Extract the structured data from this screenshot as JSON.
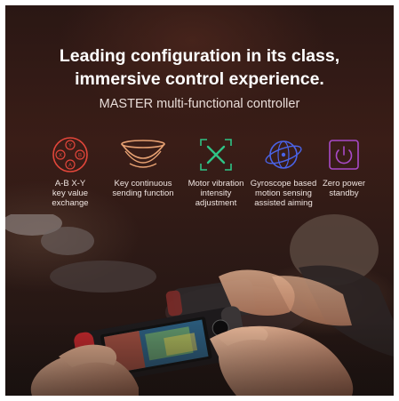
{
  "headline": {
    "line1": "Leading configuration in its class,",
    "line2": "immersive control experience."
  },
  "subtitle": "MASTER multi-functional controller",
  "features": [
    {
      "icon": "abxy-buttons-icon",
      "label": "A-B X-Y\nkey value\nexchange",
      "color": "#e2463a"
    },
    {
      "icon": "stacked-bowls-icon",
      "label": "Key continuous\nsending function",
      "color": "#e8a273"
    },
    {
      "icon": "vibration-x-icon",
      "label": "Motor vibration\nintensity\nadjustment",
      "color": "#2fc486"
    },
    {
      "icon": "gyroscope-icon",
      "label": "Gyroscope based\nmotion sensing\nassisted aiming",
      "color": "#4a63e6"
    },
    {
      "icon": "power-icon",
      "label": "Zero power\nstandby",
      "color": "#a84ac8"
    }
  ],
  "photo": {
    "subject": "hands-holding-handheld-console"
  }
}
